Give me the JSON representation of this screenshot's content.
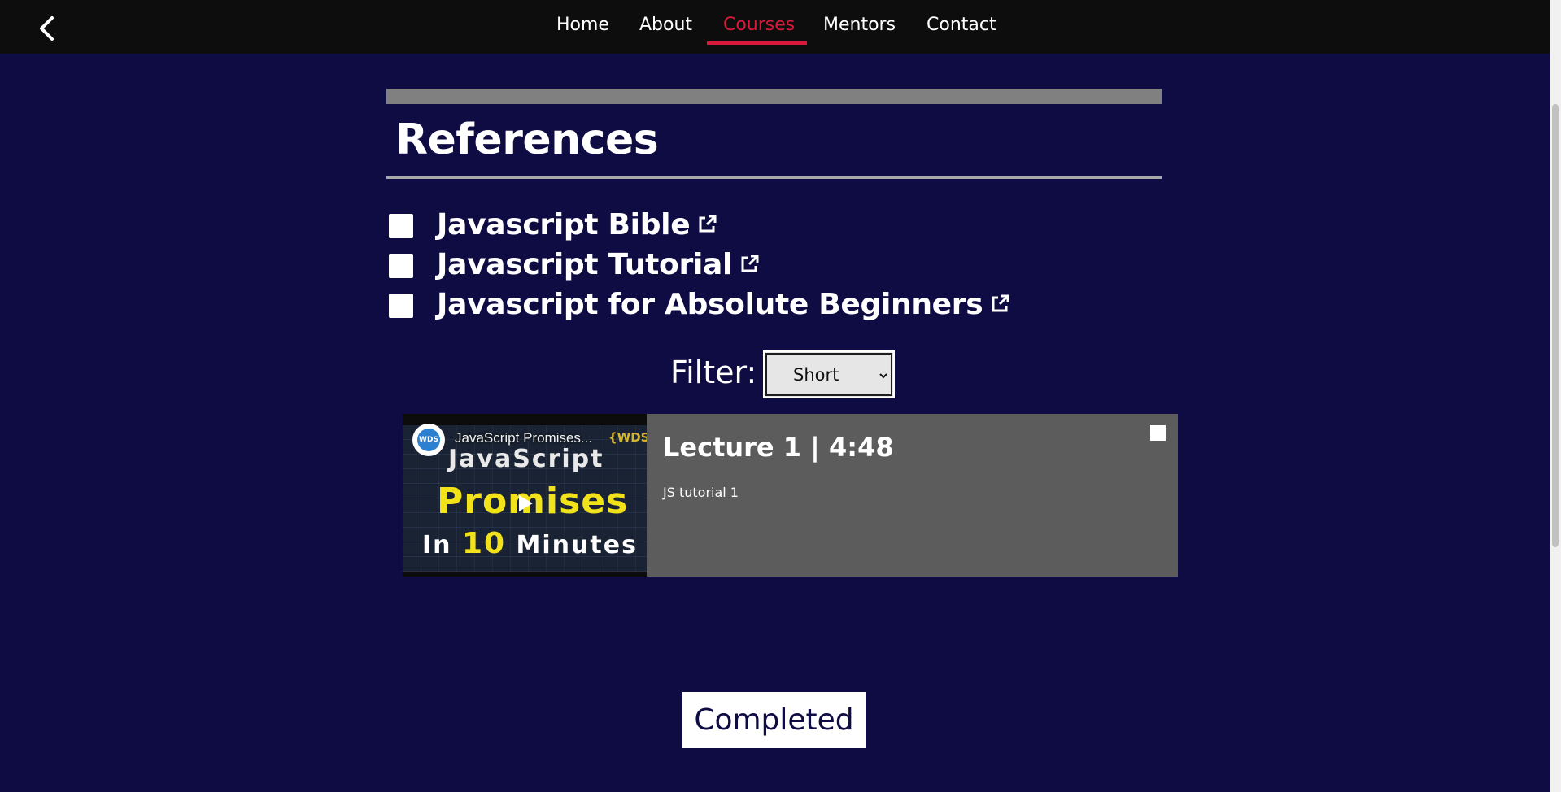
{
  "nav": {
    "items": [
      {
        "label": "Home"
      },
      {
        "label": "About"
      },
      {
        "label": "Courses",
        "active": true
      },
      {
        "label": "Mentors"
      },
      {
        "label": "Contact"
      }
    ],
    "active_color": "#d7193a"
  },
  "section": {
    "title": "References"
  },
  "references": [
    {
      "label": "Javascript Bible",
      "checked": false,
      "icon": "external-link-icon"
    },
    {
      "label": "Javascript Tutorial",
      "checked": false,
      "icon": "external-link-icon"
    },
    {
      "label": "Javascript for Absolute Beginners",
      "checked": false,
      "icon": "external-link-icon"
    }
  ],
  "filter": {
    "label": "Filter:",
    "selected": "Short"
  },
  "lecture": {
    "title": "Lecture 1 | 4:48",
    "description": "JS tutorial 1",
    "checked": false,
    "video": {
      "title": "JavaScript Promises...",
      "thumb_line1": "JavaScript",
      "thumb_line2": "Promises",
      "thumb_line3_prefix": "In",
      "thumb_line3_number": "10",
      "thumb_line3_suffix": "Minutes",
      "channel_badge": "WDS",
      "logo_text": "{WDS}"
    }
  },
  "completed_button": "Completed",
  "colors": {
    "background": "#0e0c43",
    "topbar": "#0d0d0d",
    "card": "#5c5c5c",
    "accent": "#d7193a"
  }
}
